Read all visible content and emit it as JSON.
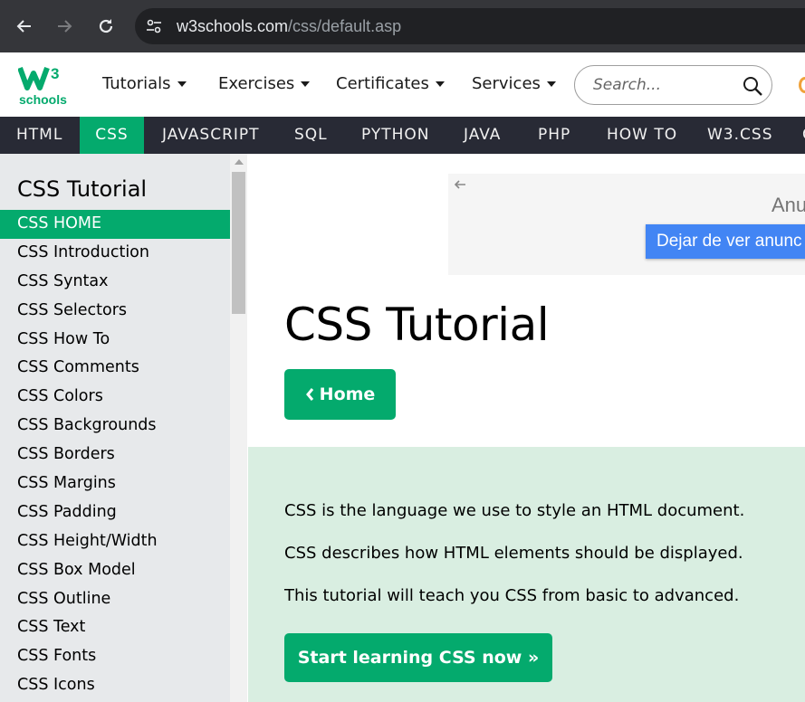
{
  "browser": {
    "url_host": "w3schools.com",
    "url_path": "/css/default.asp",
    "icons": [
      "back-icon",
      "forward-icon",
      "reload-icon",
      "site-info-icon"
    ]
  },
  "header": {
    "logo_text": "schools",
    "logo_superscript": "3",
    "menu": [
      {
        "label": "Tutorials"
      },
      {
        "label": "Exercises"
      },
      {
        "label": "Certificates"
      },
      {
        "label": "Services"
      }
    ],
    "search_placeholder": "Search..."
  },
  "topnav": {
    "items": [
      "HTML",
      "CSS",
      "JAVASCRIPT",
      "SQL",
      "PYTHON",
      "JAVA",
      "PHP",
      "HOW TO",
      "W3.CSS",
      "C"
    ],
    "active": "CSS"
  },
  "sidebar": {
    "heading": "CSS Tutorial",
    "items": [
      "CSS HOME",
      "CSS Introduction",
      "CSS Syntax",
      "CSS Selectors",
      "CSS How To",
      "CSS Comments",
      "CSS Colors",
      "CSS Backgrounds",
      "CSS Borders",
      "CSS Margins",
      "CSS Padding",
      "CSS Height/Width",
      "CSS Box Model",
      "CSS Outline",
      "CSS Text",
      "CSS Fonts",
      "CSS Icons"
    ],
    "active": "CSS HOME"
  },
  "ad": {
    "label": "Anu",
    "stop_button": "Dejar de ver anunc"
  },
  "main": {
    "title": "CSS Tutorial",
    "home_button": "Home",
    "intro": [
      "CSS is the language we use to style an HTML document.",
      "CSS describes how HTML elements should be displayed.",
      "This tutorial will teach you CSS from basic to advanced."
    ],
    "start_button": "Start learning CSS now »"
  },
  "colors": {
    "accent": "#04aa6d",
    "nav_bg": "#282a35",
    "sidebar_bg": "#e7e9eb",
    "intro_bg": "#d9eee1",
    "chrome_bg": "#35363a"
  }
}
